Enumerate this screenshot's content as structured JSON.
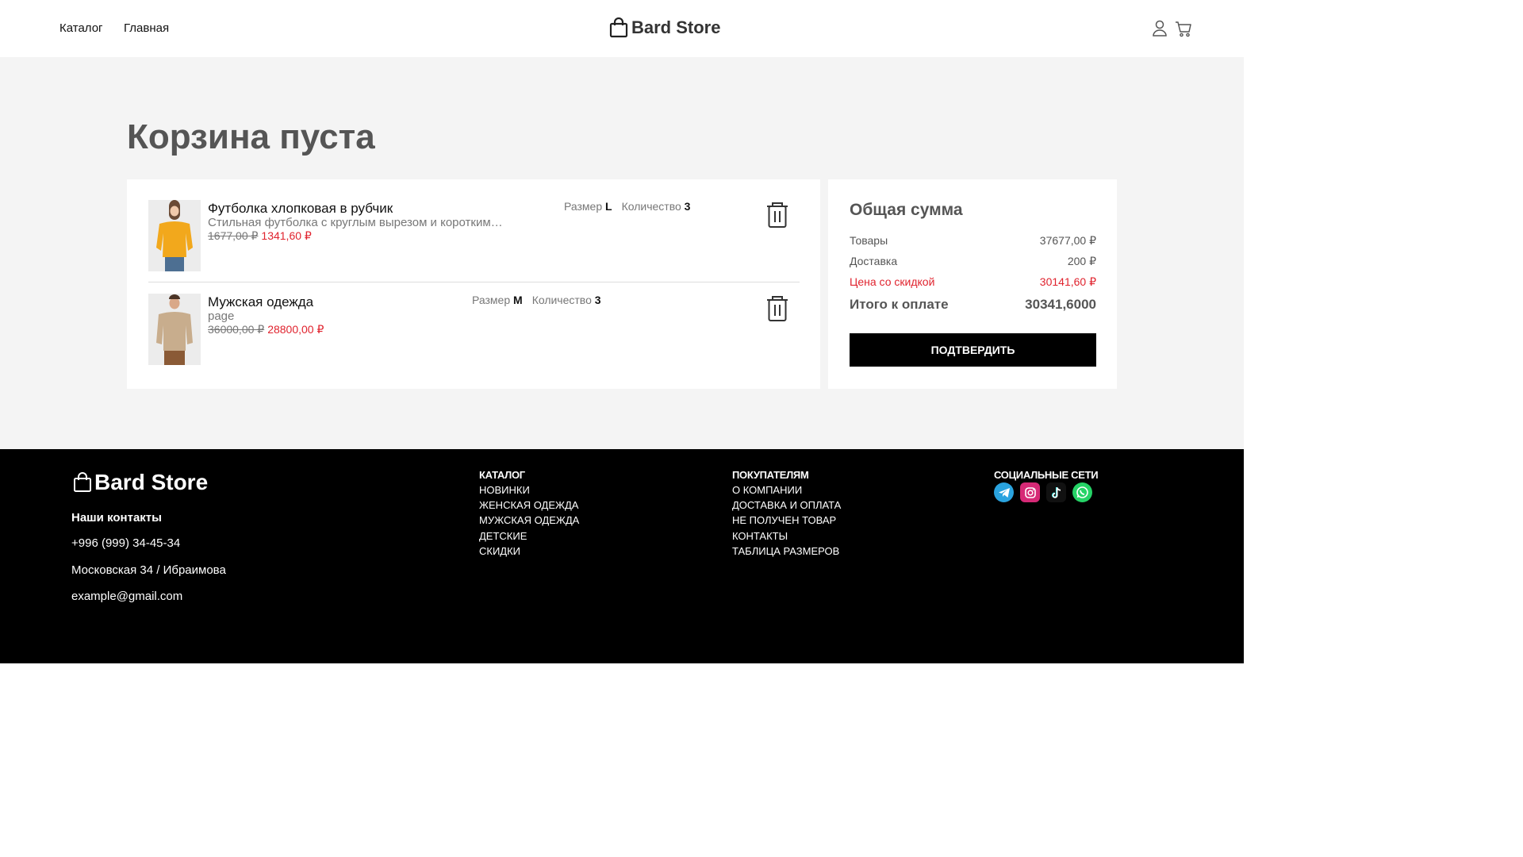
{
  "header": {
    "nav": [
      "Каталог",
      "Главная"
    ],
    "logo": "Bard Store"
  },
  "cart": {
    "title": "Корзина пуста",
    "items": [
      {
        "name": "Футболка хлопковая в рубчик",
        "description": "Стильная футболка с круглым вырезом и короткими рукавами",
        "old_price": "1677,00 ₽",
        "new_price": "1341,60 ₽",
        "size_label": "Размер",
        "size": "L",
        "qty_label": "Количество",
        "qty": "3"
      },
      {
        "name": "Мужская одежда",
        "description": "page",
        "old_price": "36000,00 ₽",
        "new_price": "28800,00 ₽",
        "size_label": "Размер",
        "size": "M",
        "qty_label": "Количество",
        "qty": "3"
      }
    ]
  },
  "summary": {
    "title": "Общая сумма",
    "goods_label": "Товары",
    "goods_value": "37677,00 ₽",
    "delivery_label": "Доставка",
    "delivery_value": "200 ₽",
    "discount_label": "Цена со скидкой",
    "discount_value": "30141,60 ₽",
    "total_label": "Итого к оплате",
    "total_value": "30341,6000",
    "confirm": "ПОДТВЕРДИТЬ"
  },
  "footer": {
    "logo": "Bard Store",
    "contacts_title": "Наши контакты",
    "phone": "+996 (999) 34-45-34",
    "address": "Московская 34 / Ибраимова",
    "email": "example@gmail.com",
    "catalog": {
      "title": "КАТАЛОГ",
      "links": [
        "НОВИНКИ",
        "ЖЕНСКАЯ ОДЕЖДА",
        "МУЖСКАЯ ОДЕЖДА",
        "ДЕТСКИЕ",
        "СКИДКИ"
      ]
    },
    "buyers": {
      "title": "ПОКУПАТЕЛЯМ",
      "links": [
        "О КОМПАНИИ",
        "ДОСТАВКА И ОПЛАТА",
        "НЕ ПОЛУЧЕН ТОВАР",
        "КОНТАКТЫ",
        "ТАБЛИЦА РАЗМЕРОВ"
      ]
    },
    "social": {
      "title": "СОЦИАЛЬНЫЕ СЕТИ",
      "icons": [
        "telegram-icon",
        "instagram-icon",
        "tiktok-icon",
        "whatsapp-icon"
      ]
    }
  },
  "colors": {
    "accent_red": "#e0232e",
    "background": "#f4f4f4",
    "footer": "#000000"
  }
}
